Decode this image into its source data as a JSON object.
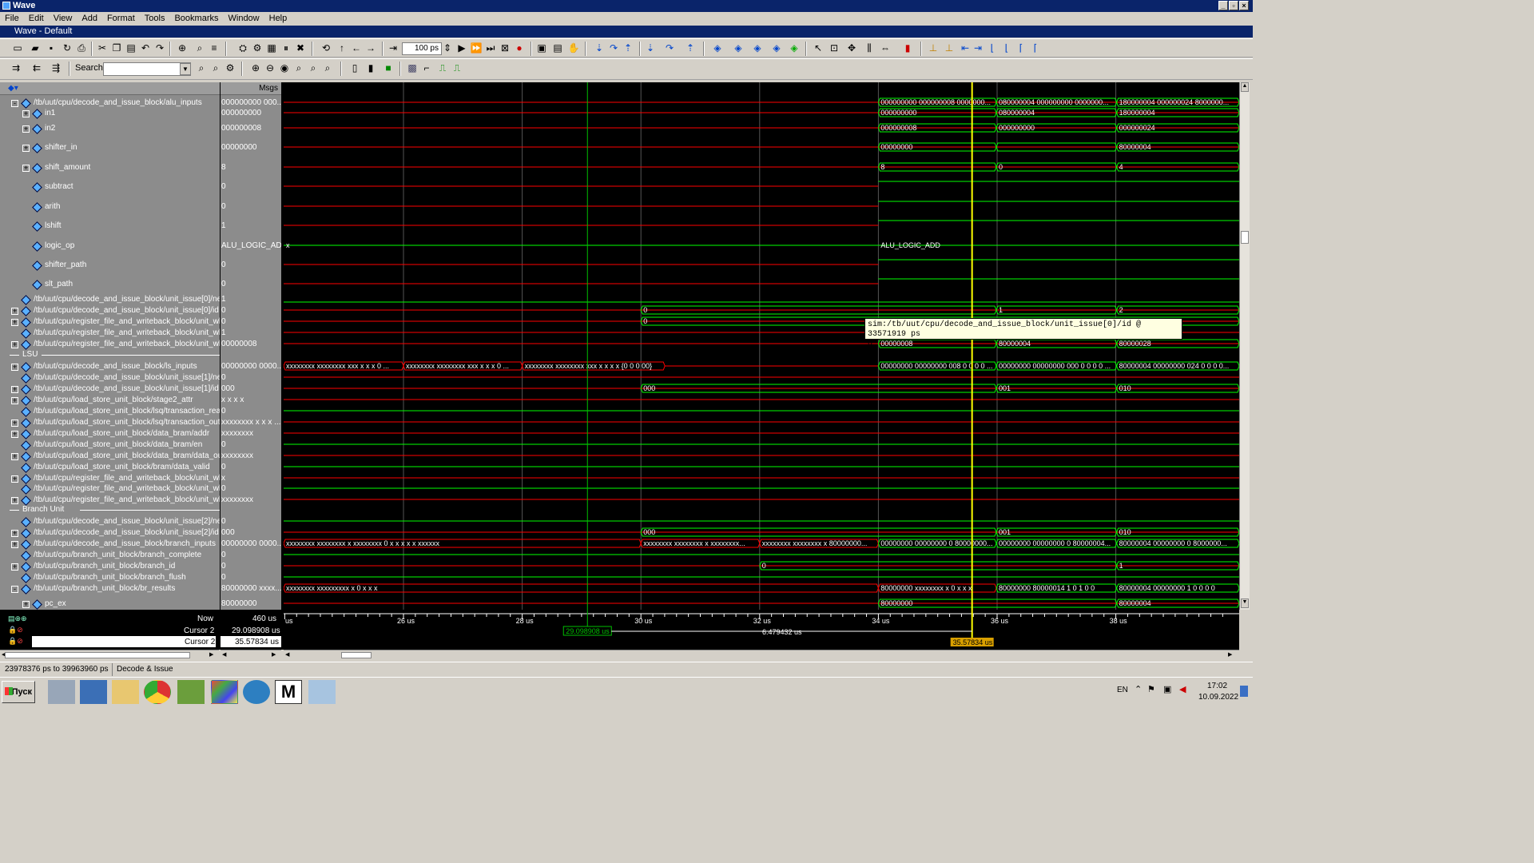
{
  "window": {
    "title": "Wave",
    "subtitle": "Wave - Default"
  },
  "menu": [
    "File",
    "Edit",
    "View",
    "Add",
    "Format",
    "Tools",
    "Bookmarks",
    "Window",
    "Help"
  ],
  "toolbar": {
    "time_value": "100 ps",
    "search_label": "Search:",
    "search_value": ""
  },
  "panes": {
    "msgs_header": "Msgs"
  },
  "signals": [
    {
      "name": "/tb/uut/cpu/decode_and_issue_block/alu_inputs",
      "value": "000000000 000...",
      "indent": 0,
      "expand": "-"
    },
    {
      "name": "in1",
      "value": "000000000",
      "indent": 1,
      "expand": "+"
    },
    {
      "name": "in2",
      "value": "000000008",
      "indent": 1,
      "expand": "+"
    },
    {
      "name": "shifter_in",
      "value": "00000000",
      "indent": 1,
      "expand": "+"
    },
    {
      "name": "shift_amount",
      "value": "8",
      "indent": 1,
      "expand": "+"
    },
    {
      "name": "subtract",
      "value": "0",
      "indent": 1,
      "expand": ""
    },
    {
      "name": "arith",
      "value": "0",
      "indent": 1,
      "expand": ""
    },
    {
      "name": "lshift",
      "value": "1",
      "indent": 1,
      "expand": ""
    },
    {
      "name": "logic_op",
      "value": "ALU_LOGIC_ADD",
      "indent": 1,
      "expand": ""
    },
    {
      "name": "shifter_path",
      "value": "0",
      "indent": 1,
      "expand": ""
    },
    {
      "name": "slt_path",
      "value": "0",
      "indent": 1,
      "expand": ""
    },
    {
      "name": "/tb/uut/cpu/decode_and_issue_block/unit_issue[0]/new...",
      "value": "1",
      "indent": 0,
      "expand": ""
    },
    {
      "name": "/tb/uut/cpu/decode_and_issue_block/unit_issue[0]/id",
      "value": "0",
      "indent": 0,
      "expand": "+"
    },
    {
      "name": "/tb/uut/cpu/register_file_and_writeback_block/unit_wb[...",
      "value": "0",
      "indent": 0,
      "expand": "+"
    },
    {
      "name": "/tb/uut/cpu/register_file_and_writeback_block/unit_wb[...",
      "value": "1",
      "indent": 0,
      "expand": ""
    },
    {
      "name": "/tb/uut/cpu/register_file_and_writeback_block/unit_wb[...",
      "value": "00000008",
      "indent": 0,
      "expand": "+"
    },
    {
      "name": "/tb/uut/cpu/decode_and_issue_block/ls_inputs",
      "value": "00000000 0000...",
      "indent": 0,
      "expand": "+"
    },
    {
      "name": "/tb/uut/cpu/decode_and_issue_block/unit_issue[1]/new...",
      "value": "0",
      "indent": 0,
      "expand": ""
    },
    {
      "name": "/tb/uut/cpu/decode_and_issue_block/unit_issue[1]/id",
      "value": "000",
      "indent": 0,
      "expand": "+"
    },
    {
      "name": "/tb/uut/cpu/load_store_unit_block/stage2_attr",
      "value": "x x x x",
      "indent": 0,
      "expand": "+"
    },
    {
      "name": "/tb/uut/cpu/load_store_unit_block/lsq/transaction_ready",
      "value": "0",
      "indent": 0,
      "expand": ""
    },
    {
      "name": "/tb/uut/cpu/load_store_unit_block/lsq/transaction_out",
      "value": "xxxxxxxx x x x ...",
      "indent": 0,
      "expand": "+"
    },
    {
      "name": "/tb/uut/cpu/load_store_unit_block/data_bram/addr",
      "value": "xxxxxxxx",
      "indent": 0,
      "expand": "+"
    },
    {
      "name": "/tb/uut/cpu/load_store_unit_block/data_bram/en",
      "value": "0",
      "indent": 0,
      "expand": ""
    },
    {
      "name": "/tb/uut/cpu/load_store_unit_block/data_bram/data_out",
      "value": "xxxxxxxx",
      "indent": 0,
      "expand": "+"
    },
    {
      "name": "/tb/uut/cpu/load_store_unit_block/bram/data_valid",
      "value": "0",
      "indent": 0,
      "expand": ""
    },
    {
      "name": "/tb/uut/cpu/register_file_and_writeback_block/unit_wb[...",
      "value": "x",
      "indent": 0,
      "expand": "+"
    },
    {
      "name": "/tb/uut/cpu/register_file_and_writeback_block/unit_wb[...",
      "value": "0",
      "indent": 0,
      "expand": ""
    },
    {
      "name": "/tb/uut/cpu/register_file_and_writeback_block/unit_wb[...",
      "value": "xxxxxxxx",
      "indent": 0,
      "expand": "+"
    },
    {
      "name": "/tb/uut/cpu/decode_and_issue_block/unit_issue[2]/new...",
      "value": "0",
      "indent": 0,
      "expand": ""
    },
    {
      "name": "/tb/uut/cpu/decode_and_issue_block/unit_issue[2]/id",
      "value": "000",
      "indent": 0,
      "expand": "+"
    },
    {
      "name": "/tb/uut/cpu/decode_and_issue_block/branch_inputs",
      "value": "00000000 0000...",
      "indent": 0,
      "expand": "+"
    },
    {
      "name": "/tb/uut/cpu/branch_unit_block/branch_complete",
      "value": "0",
      "indent": 0,
      "expand": ""
    },
    {
      "name": "/tb/uut/cpu/branch_unit_block/branch_id",
      "value": "0",
      "indent": 0,
      "expand": "+"
    },
    {
      "name": "/tb/uut/cpu/branch_unit_block/branch_flush",
      "value": "0",
      "indent": 0,
      "expand": ""
    },
    {
      "name": "/tb/uut/cpu/branch_unit_block/br_results",
      "value": "80000000 xxxx...",
      "indent": 0,
      "expand": "-"
    },
    {
      "name": "pc_ex",
      "value": "80000000",
      "indent": 1,
      "expand": "+"
    }
  ],
  "groups": [
    "LSU",
    "Branch Unit"
  ],
  "wave_labels": [
    "000000000 000000008 0000000...",
    "080000004 000000000 0000000...",
    "180000004 000000024 8000000...",
    "000000000",
    "080000004",
    "180000004",
    "000000008",
    "000000000",
    "000000024",
    "00000000",
    "80000004",
    "8",
    "0",
    "4",
    "x",
    "ALU_LOGIC_ADD",
    "0",
    "1",
    "2",
    "0",
    "00000008",
    "80000004",
    "80000028",
    "xxxxxxxx xxxxxxxx xxx x x x 0 ...",
    "xxxxxxxx xxxxxxxx xxx x x x 0 ...",
    "xxxxxxxx xxxxxxxx xxx x x x x {0 0 0 00}",
    "00000000 00000000 008 0 0 0 0 ...",
    "00000000 00000000 000 0 0 0 0 ...",
    "80000004 00000000 024 0 0 0 0...",
    "000",
    "001",
    "010",
    "000",
    "001",
    "010",
    "xxxxxxxx xxxxxxxx x xxxxxxxx 0 x x x x x xxxxxx",
    "xxxxxxxx xxxxxxxx x xxxxxxxx...",
    "xxxxxxxx xxxxxxxx x 80000000...",
    "00000000 00000000 0 80000000...",
    "00000000 00000000 0 80000004...",
    "80000004 00000000 0 8000000...",
    "0",
    "1",
    "xxxxxxxx xxxxxxxxx x 0 x x x",
    "80000000 xxxxxxxx x 0 x x x",
    "80000000 80000014 1 0 1 0 0",
    "80000004 00000000 1 0 0 0 0",
    "80000000",
    "80000004"
  ],
  "tooltip": {
    "line1": "sim:/tb/uut/cpu/decode_and_issue_block/unit_issue[0]/id @ 33571919 ps",
    "line2": "0"
  },
  "footer": {
    "now_label": "Now",
    "now_value": "460 us",
    "cycle_label": "Cycle #1",
    "cycle_value": "29.098908 us",
    "cursor_label": "Cursor 2",
    "cursor_value": "35.57834 us",
    "cursor1_marker": "29.098908 us",
    "delta": "6.479432 us",
    "cursor2_marker": "35.57834 us"
  },
  "time_axis": [
    "us",
    "26 us",
    "28 us",
    "30 us",
    "32 us",
    "34 us",
    "36 us",
    "38 us"
  ],
  "statusbar": {
    "range": "23978376 ps to 39963960 ps",
    "context": "Decode & Issue"
  },
  "taskbar": {
    "start": "Пуск",
    "lang": "EN",
    "time": "17:02",
    "date": "10.09.2022"
  },
  "colors": {
    "wave_green": "#00ff00",
    "wave_red": "#ff0000",
    "cursor_yellow": "#ffff00",
    "cursor_green": "#00c000"
  }
}
